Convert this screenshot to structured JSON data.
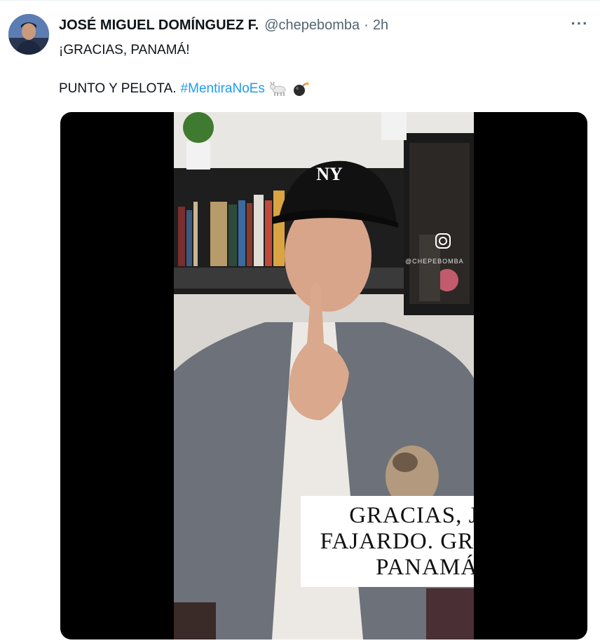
{
  "tweet": {
    "author_name": "JOSÉ MIGUEL DOMÍNGUEZ F.",
    "handle": "@chepebomba",
    "separator": "·",
    "time": "2h",
    "more_label": "···",
    "line1": "¡GRACIAS, PANAMÁ!",
    "line2_text": "PUNTO Y PELOTA.",
    "hashtag": "#MentiraNoEs",
    "emojis": [
      "goat-emoji",
      "bomb-emoji"
    ]
  },
  "video": {
    "caption": "GRACIAS, JOSÉ FAJARDO. GRACIAS, PANAMÁ...",
    "watermark": "@CHEPEBOMBA"
  },
  "colors": {
    "link": "#1d9bf0",
    "secondary_text": "#536471",
    "primary_text": "#0f1419"
  }
}
